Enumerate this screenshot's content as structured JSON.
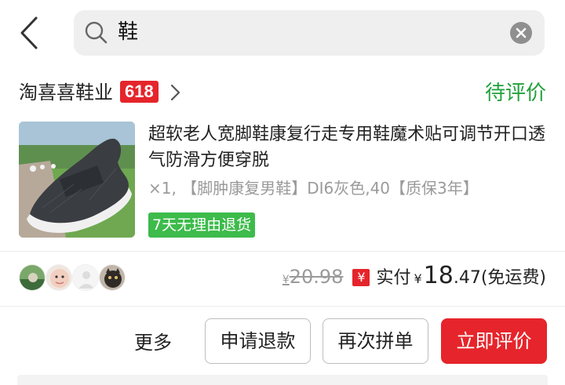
{
  "search": {
    "query": "鞋"
  },
  "shop": {
    "name": "淘喜喜鞋业",
    "badge": "618",
    "status": "待评价"
  },
  "product": {
    "title": "超软老人宽脚鞋康复行走专用鞋魔术贴可调节开口透气防滑方便穿脱",
    "spec": "×1,  【脚肿康复男鞋】DI6灰色,40【质保3年】",
    "tag": "7天无理由退货"
  },
  "price": {
    "original_currency": "¥",
    "original": "20.98",
    "paid_badge": "¥",
    "paid_label": "实付",
    "paid_currency": "¥",
    "paid_int": "18",
    "paid_dec": ".47",
    "shipping": "(免运费)"
  },
  "actions": {
    "more": "更多",
    "refund": "申请退款",
    "rebuy": "再次拼单",
    "review": "立即评价"
  },
  "colors": {
    "accent_red": "#e5252b",
    "status_green": "#21a13b",
    "tag_green": "#3dbb4b"
  },
  "icons": [
    "back-chevron-icon",
    "search-icon",
    "clear-icon",
    "chevron-right-icon",
    "yen-icon"
  ]
}
